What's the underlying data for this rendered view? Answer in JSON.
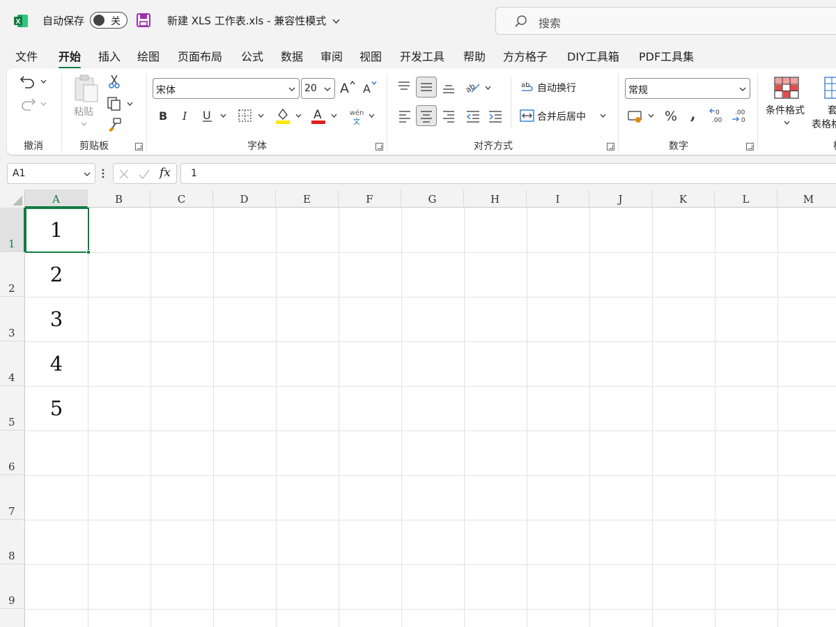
{
  "titlebar": {
    "autosave_label": "自动保存",
    "autosave_state": "关",
    "document_title": "新建 XLS 工作表.xls  -  兼容性模式",
    "search_placeholder": "搜索"
  },
  "tabs": [
    {
      "label": "文件",
      "active": false
    },
    {
      "label": "开始",
      "active": true
    },
    {
      "label": "插入",
      "active": false
    },
    {
      "label": "绘图",
      "active": false
    },
    {
      "label": "页面布局",
      "active": false
    },
    {
      "label": "公式",
      "active": false
    },
    {
      "label": "数据",
      "active": false
    },
    {
      "label": "审阅",
      "active": false
    },
    {
      "label": "视图",
      "active": false
    },
    {
      "label": "开发工具",
      "active": false
    },
    {
      "label": "帮助",
      "active": false
    },
    {
      "label": "方方格子",
      "active": false
    },
    {
      "label": "DIY工具箱",
      "active": false
    },
    {
      "label": "PDF工具集",
      "active": false
    }
  ],
  "ribbon": {
    "undo_group": {
      "label": "撤消"
    },
    "clipboard_group": {
      "label": "剪贴板",
      "paste_label": "粘贴"
    },
    "font_group": {
      "label": "字体",
      "font_name": "宋体",
      "font_size": "20",
      "phonetic_top": "wén",
      "phonetic_bottom": "文"
    },
    "alignment_group": {
      "label": "对齐方式",
      "wrap_text": "自动换行",
      "merge_center": "合并后居中"
    },
    "number_group": {
      "label": "数字",
      "number_format": "常规"
    },
    "styles_group": {
      "conditional_format": "条件格式",
      "table_format_partial_top": "套",
      "table_format_partial_bottom": "表格格",
      "label_partial": "样"
    }
  },
  "formula_bar": {
    "name_box": "A1",
    "fx_label": "fx",
    "content": "1"
  },
  "sheet": {
    "columns": [
      "A",
      "B",
      "C",
      "D",
      "E",
      "F",
      "G",
      "H",
      "I",
      "J",
      "K",
      "L",
      "M"
    ],
    "rows": [
      "1",
      "2",
      "3",
      "4",
      "5",
      "6",
      "7",
      "8",
      "9"
    ],
    "selected_cell": "A1",
    "column_a_values": [
      "1",
      "2",
      "3",
      "4",
      "5"
    ]
  },
  "colors": {
    "accent": "#107c41",
    "background": "#f3f3f3",
    "highlight_yellow": "#ffe500",
    "font_red": "#e0201b"
  }
}
